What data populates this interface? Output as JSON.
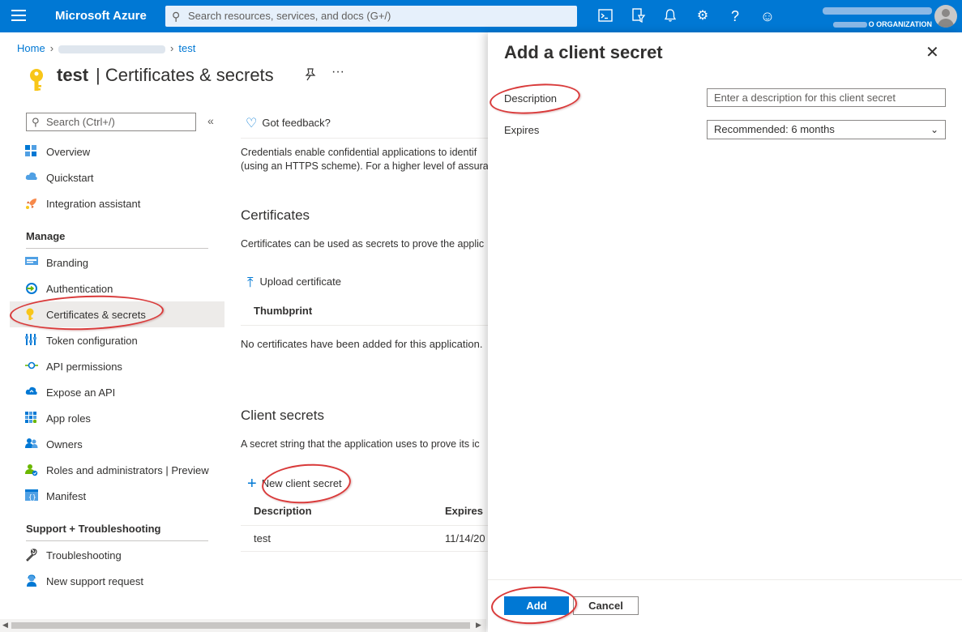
{
  "topbar": {
    "brand": "Microsoft Azure",
    "search_placeholder": "Search resources, services, and docs (G+/)",
    "icons": [
      "cloud-shell-icon",
      "directory-filter-icon",
      "notifications-icon",
      "settings-icon",
      "help-icon",
      "feedback-icon"
    ],
    "account_org_suffix": "O ORGANIZATION"
  },
  "breadcrumb": {
    "home": "Home",
    "current": "test"
  },
  "page": {
    "app_name": "test",
    "title": "| Certificates & secrets",
    "more": "···"
  },
  "nav": {
    "search_placeholder": "Search (Ctrl+/)",
    "collapse": "«",
    "top_items": [
      {
        "label": "Overview",
        "icon": "overview-icon"
      },
      {
        "label": "Quickstart",
        "icon": "quickstart-icon"
      },
      {
        "label": "Integration assistant",
        "icon": "rocket-icon"
      }
    ],
    "manage_header": "Manage",
    "manage_items": [
      {
        "label": "Branding",
        "icon": "branding-icon"
      },
      {
        "label": "Authentication",
        "icon": "authentication-icon"
      },
      {
        "label": "Certificates & secrets",
        "icon": "key-icon",
        "active": true
      },
      {
        "label": "Token configuration",
        "icon": "token-icon"
      },
      {
        "label": "API permissions",
        "icon": "api-permissions-icon"
      },
      {
        "label": "Expose an API",
        "icon": "cloud-icon"
      },
      {
        "label": "App roles",
        "icon": "app-roles-icon"
      },
      {
        "label": "Owners",
        "icon": "owners-icon"
      },
      {
        "label": "Roles and administrators | Preview",
        "icon": "roles-icon"
      },
      {
        "label": "Manifest",
        "icon": "manifest-icon"
      }
    ],
    "support_header": "Support + Troubleshooting",
    "support_items": [
      {
        "label": "Troubleshooting",
        "icon": "wrench-icon"
      },
      {
        "label": "New support request",
        "icon": "support-person-icon"
      }
    ]
  },
  "main": {
    "feedback": "Got feedback?",
    "intro_line1": "Credentials enable confidential applications to identif",
    "intro_line2": "(using an HTTPS scheme). For a higher level of assura",
    "certificates": {
      "heading": "Certificates",
      "description": "Certificates can be used as secrets to prove the applic",
      "upload": "Upload certificate",
      "column": "Thumbprint",
      "empty": "No certificates have been added for this application."
    },
    "client_secrets": {
      "heading": "Client secrets",
      "description": "A secret string that the application uses to prove its ic",
      "new_button": "New client secret",
      "columns": [
        "Description",
        "Expires"
      ],
      "rows": [
        {
          "description": "test",
          "expires": "11/14/20"
        }
      ]
    }
  },
  "panel": {
    "title": "Add a client secret",
    "description_label": "Description",
    "description_placeholder": "Enter a description for this client secret",
    "expires_label": "Expires",
    "expires_value": "Recommended: 6 months",
    "add_button": "Add",
    "cancel_button": "Cancel"
  },
  "colors": {
    "accent": "#0078d4",
    "annotation": "#d93a3a"
  }
}
